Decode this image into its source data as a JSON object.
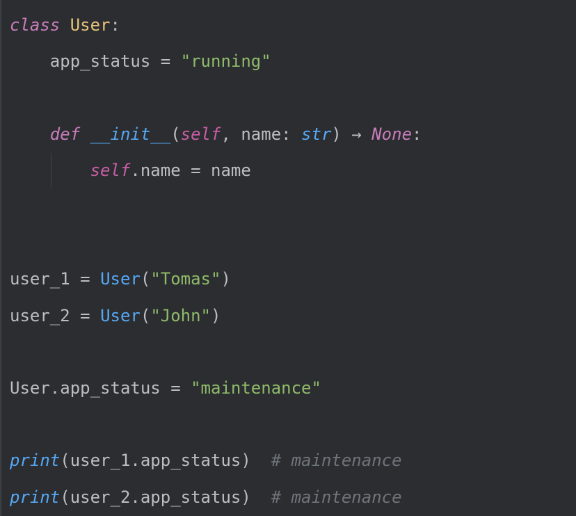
{
  "editor": {
    "language": "python",
    "colors": {
      "background": "#2b2d30",
      "keyword": "#c77dbb",
      "class_name": "#e8c47b",
      "string": "#8fbb6a",
      "function": "#56a8f5",
      "self": "#c75fa5",
      "comment": "#6f737a",
      "default": "#bcbec4"
    },
    "lines": [
      {
        "tokens": [
          {
            "t": "class",
            "c": "kw"
          },
          {
            "t": " ",
            "c": "punc"
          },
          {
            "t": "User",
            "c": "cls"
          },
          {
            "t": ":",
            "c": "punc"
          }
        ]
      },
      {
        "tokens": [
          {
            "t": "    app_status ",
            "c": "var"
          },
          {
            "t": "=",
            "c": "op"
          },
          {
            "t": " ",
            "c": "punc"
          },
          {
            "t": "\"running\"",
            "c": "str"
          }
        ]
      },
      {
        "tokens": []
      },
      {
        "tokens": [
          {
            "t": "    ",
            "c": "punc"
          },
          {
            "t": "def",
            "c": "kw"
          },
          {
            "t": " ",
            "c": "punc"
          },
          {
            "t": "__init__",
            "c": "dunder"
          },
          {
            "t": "(",
            "c": "punc"
          },
          {
            "t": "self",
            "c": "self"
          },
          {
            "t": ", name: ",
            "c": "var"
          },
          {
            "t": "str",
            "c": "type"
          },
          {
            "t": ") ",
            "c": "punc"
          },
          {
            "t": "→",
            "c": "op"
          },
          {
            "t": " ",
            "c": "punc"
          },
          {
            "t": "None",
            "c": "none"
          },
          {
            "t": ":",
            "c": "punc"
          }
        ]
      },
      {
        "tokens": [
          {
            "t": "        ",
            "c": "punc"
          },
          {
            "t": "self",
            "c": "self"
          },
          {
            "t": ".name ",
            "c": "var"
          },
          {
            "t": "=",
            "c": "op"
          },
          {
            "t": " name",
            "c": "var"
          }
        ]
      },
      {
        "tokens": []
      },
      {
        "tokens": []
      },
      {
        "tokens": [
          {
            "t": "user_1 ",
            "c": "var"
          },
          {
            "t": "=",
            "c": "op"
          },
          {
            "t": " ",
            "c": "punc"
          },
          {
            "t": "User",
            "c": "call"
          },
          {
            "t": "(",
            "c": "punc"
          },
          {
            "t": "\"Tomas\"",
            "c": "str"
          },
          {
            "t": ")",
            "c": "punc"
          }
        ]
      },
      {
        "tokens": [
          {
            "t": "user_2 ",
            "c": "var"
          },
          {
            "t": "=",
            "c": "op"
          },
          {
            "t": " ",
            "c": "punc"
          },
          {
            "t": "User",
            "c": "call"
          },
          {
            "t": "(",
            "c": "punc"
          },
          {
            "t": "\"John\"",
            "c": "str"
          },
          {
            "t": ")",
            "c": "punc"
          }
        ]
      },
      {
        "tokens": []
      },
      {
        "tokens": [
          {
            "t": "User.app_status ",
            "c": "var"
          },
          {
            "t": "=",
            "c": "op"
          },
          {
            "t": " ",
            "c": "punc"
          },
          {
            "t": "\"maintenance\"",
            "c": "str"
          }
        ]
      },
      {
        "tokens": []
      },
      {
        "tokens": [
          {
            "t": "print",
            "c": "builtin"
          },
          {
            "t": "(user_1.app_status)",
            "c": "var"
          },
          {
            "t": "  ",
            "c": "punc"
          },
          {
            "t": "# maintenance",
            "c": "comment"
          }
        ]
      },
      {
        "tokens": [
          {
            "t": "print",
            "c": "builtin"
          },
          {
            "t": "(user_2.app_status)",
            "c": "var"
          },
          {
            "t": "  ",
            "c": "punc"
          },
          {
            "t": "# maintenance",
            "c": "comment"
          }
        ]
      }
    ]
  }
}
